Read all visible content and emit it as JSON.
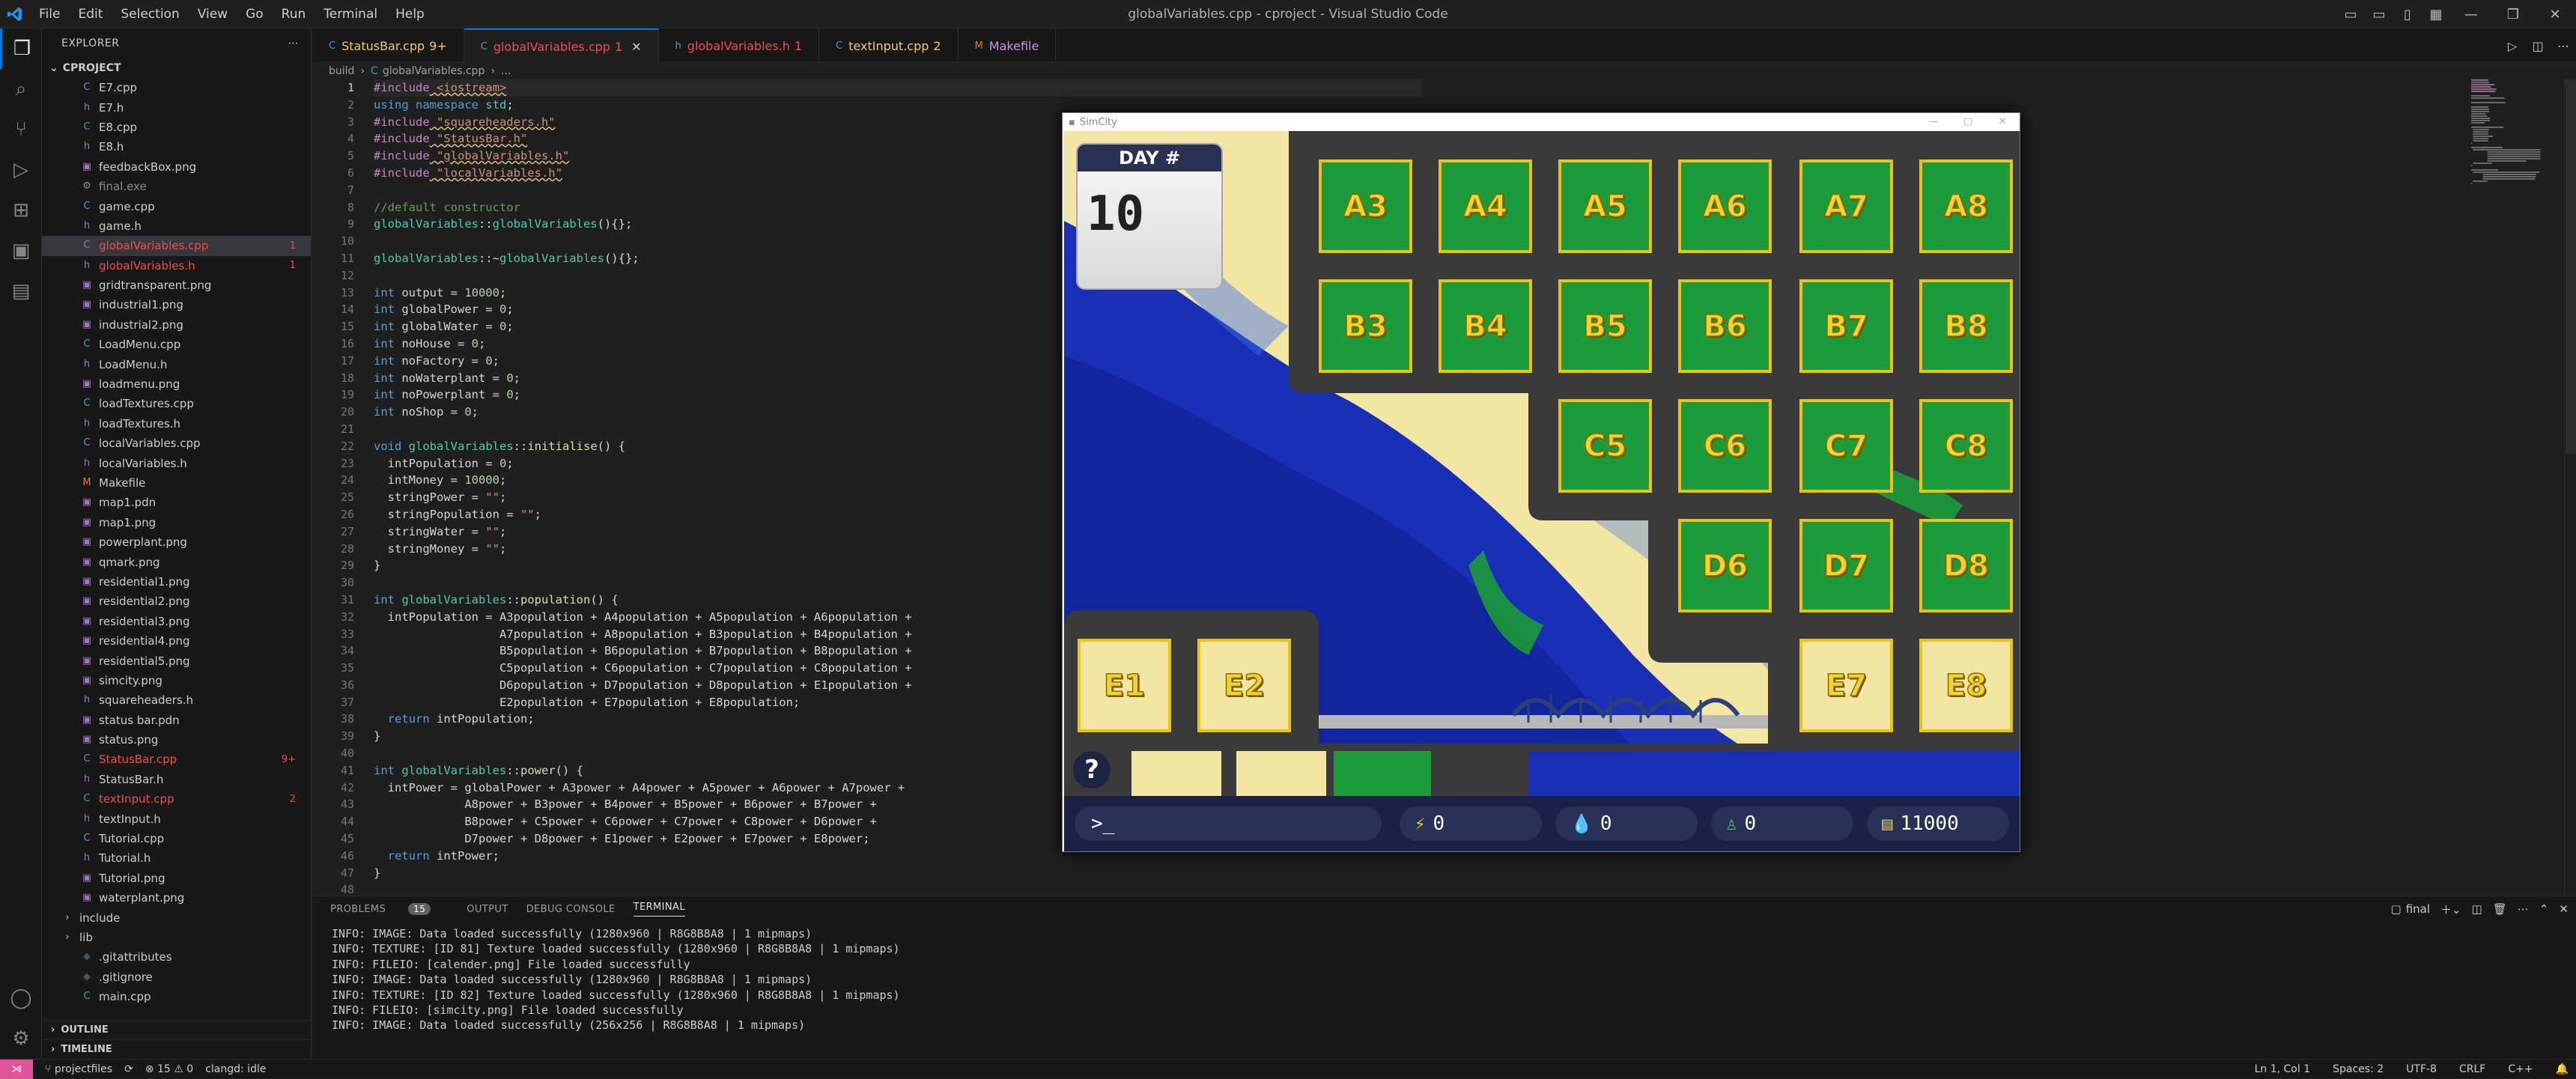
{
  "window": {
    "title": "globalVariables.cpp - cproject - Visual Studio Code"
  },
  "menu": [
    "File",
    "Edit",
    "Selection",
    "View",
    "Go",
    "Run",
    "Terminal",
    "Help"
  ],
  "activity": [
    "files-icon",
    "search-icon",
    "source-control-icon",
    "run-debug-icon",
    "extensions-icon",
    "remote-explorer-icon",
    "testing-icon"
  ],
  "sidebar": {
    "title": "EXPLORER",
    "project": "CPROJECT",
    "files": [
      {
        "name": "E7.cpp",
        "color": "#cccccc"
      },
      {
        "name": "E7.h",
        "color": "#cccccc"
      },
      {
        "name": "E8.cpp",
        "color": "#cccccc"
      },
      {
        "name": "E8.h",
        "color": "#cccccc"
      },
      {
        "name": "feedbackBox.png",
        "color": "#cccccc"
      },
      {
        "name": "final.exe",
        "color": "#8a8a8a"
      },
      {
        "name": "game.cpp",
        "color": "#cccccc"
      },
      {
        "name": "game.h",
        "color": "#cccccc"
      },
      {
        "name": "globalVariables.cpp",
        "color": "#f14c4c",
        "badge": "1",
        "selected": true
      },
      {
        "name": "globalVariables.h",
        "color": "#f14c4c",
        "badge": "1"
      },
      {
        "name": "gridtransparent.png",
        "color": "#cccccc"
      },
      {
        "name": "industrial1.png",
        "color": "#cccccc"
      },
      {
        "name": "industrial2.png",
        "color": "#cccccc"
      },
      {
        "name": "LoadMenu.cpp",
        "color": "#cccccc"
      },
      {
        "name": "LoadMenu.h",
        "color": "#cccccc"
      },
      {
        "name": "loadmenu.png",
        "color": "#cccccc"
      },
      {
        "name": "loadTextures.cpp",
        "color": "#cccccc"
      },
      {
        "name": "loadTextures.h",
        "color": "#cccccc"
      },
      {
        "name": "localVariables.cpp",
        "color": "#cccccc"
      },
      {
        "name": "localVariables.h",
        "color": "#cccccc"
      },
      {
        "name": "Makefile",
        "color": "#cccccc"
      },
      {
        "name": "map1.pdn",
        "color": "#cccccc"
      },
      {
        "name": "map1.png",
        "color": "#cccccc"
      },
      {
        "name": "powerplant.png",
        "color": "#cccccc"
      },
      {
        "name": "qmark.png",
        "color": "#cccccc"
      },
      {
        "name": "residential1.png",
        "color": "#cccccc"
      },
      {
        "name": "residential2.png",
        "color": "#cccccc"
      },
      {
        "name": "residential3.png",
        "color": "#cccccc"
      },
      {
        "name": "residential4.png",
        "color": "#cccccc"
      },
      {
        "name": "residential5.png",
        "color": "#cccccc"
      },
      {
        "name": "simcity.png",
        "color": "#cccccc"
      },
      {
        "name": "squareheaders.h",
        "color": "#cccccc"
      },
      {
        "name": "status bar.pdn",
        "color": "#cccccc"
      },
      {
        "name": "status.png",
        "color": "#cccccc"
      },
      {
        "name": "StatusBar.cpp",
        "color": "#f14c4c",
        "badge": "9+"
      },
      {
        "name": "StatusBar.h",
        "color": "#cccccc"
      },
      {
        "name": "textInput.cpp",
        "color": "#f14c4c",
        "badge": "2"
      },
      {
        "name": "textInput.h",
        "color": "#cccccc"
      },
      {
        "name": "Tutorial.cpp",
        "color": "#cccccc"
      },
      {
        "name": "Tutorial.h",
        "color": "#cccccc"
      },
      {
        "name": "Tutorial.png",
        "color": "#cccccc"
      },
      {
        "name": "waterplant.png",
        "color": "#cccccc"
      }
    ],
    "folders": [
      "include",
      "lib"
    ],
    "bottom_files": [
      ".gitattributes",
      ".gitignore",
      "main.cpp"
    ],
    "outline": "OUTLINE",
    "timeline": "TIMELINE"
  },
  "tabs": [
    {
      "label": "StatusBar.cpp",
      "badge": "9+",
      "color": "#f0c674"
    },
    {
      "label": "globalVariables.cpp",
      "badge": "1",
      "color": "#f14c4c",
      "active": true
    },
    {
      "label": "globalVariables.h",
      "badge": "1",
      "color": "#f14c4c"
    },
    {
      "label": "textInput.cpp",
      "badge": "2",
      "color": "#f0c674"
    },
    {
      "label": "Makefile",
      "badge": "",
      "color": "#c792ea"
    }
  ],
  "breadcrumb": [
    "build",
    "globalVariables.cpp",
    "..."
  ],
  "code": [
    "#include <iostream>",
    "using namespace std;",
    "#include \"squareheaders.h\"",
    "#include \"StatusBar.h\"",
    "#include \"globalVariables.h\"",
    "#include \"localVariables.h\"",
    "",
    "//default constructor",
    "globalVariables::globalVariables(){};",
    "",
    "globalVariables::~globalVariables(){};",
    "",
    "int output = 10000;",
    "int globalPower = 0;",
    "int globalWater = 0;",
    "int noHouse = 0;",
    "int noFactory = 0;",
    "int noWaterplant = 0;",
    "int noPowerplant = 0;",
    "int noShop = 0;",
    "",
    "void globalVariables::initialise() {",
    "  intPopulation = 0;",
    "  intMoney = 10000;",
    "  stringPower = \"\";",
    "  stringPopulation = \"\";",
    "  stringWater = \"\";",
    "  stringMoney = \"\";",
    "}",
    "",
    "int globalVariables::population() {",
    "  intPopulation = A3population + A4population + A5population + A6population +",
    "                  A7population + A8population + B3population + B4population +",
    "                  B5population + B6population + B7population + B8population +",
    "                  C5population + C6population + C7population + C8population +",
    "                  D6population + D7population + D8population + E1population +",
    "                  E2population + E7population + E8population;",
    "  return intPopulation;",
    "}",
    "",
    "int globalVariables::power() {",
    "  intPower = globalPower + A3power + A4power + A5power + A6power + A7power +",
    "             A8power + B3power + B4power + B5power + B6power + B7power +",
    "             B8power + C5power + C6power + C7power + C8power + D6power +",
    "             D7power + D8power + E1power + E2power + E7power + E8power;",
    "  return intPower;",
    "}",
    ""
  ],
  "panel": {
    "tabs": [
      "PROBLEMS",
      "OUTPUT",
      "DEBUG CONSOLE",
      "TERMINAL"
    ],
    "problems_count": "15",
    "terminal_name": "final",
    "lines": [
      "INFO: IMAGE: Data loaded successfully (1280x960 | R8G8B8A8 | 1 mipmaps)",
      "INFO: TEXTURE: [ID 81] Texture loaded successfully (1280x960 | R8G8B8A8 | 1 mipmaps)",
      "INFO: FILEIO: [calender.png] File loaded successfully",
      "INFO: IMAGE: Data loaded successfully (1280x960 | R8G8B8A8 | 1 mipmaps)",
      "INFO: TEXTURE: [ID 82] Texture loaded successfully (1280x960 | R8G8B8A8 | 1 mipmaps)",
      "INFO: FILEIO: [simcity.png] File loaded successfully",
      "INFO: IMAGE: Data loaded successfully (256x256 | R8G8B8A8 | 1 mipmaps)",
      ""
    ]
  },
  "game": {
    "title": "SimCity",
    "day_label": "DAY #",
    "day": "10",
    "help": "?",
    "prompt": ">_",
    "power": "0",
    "water": "0",
    "population": "0",
    "money": "11000",
    "plots": [
      "A3",
      "A4",
      "A5",
      "A6",
      "A7",
      "A8",
      "B3",
      "B4",
      "B5",
      "B6",
      "B7",
      "B8",
      "C5",
      "C6",
      "C7",
      "C8",
      "D6",
      "D7",
      "D8",
      "E1",
      "E2",
      "E7",
      "E8"
    ]
  },
  "status": {
    "branch": "projectfiles",
    "errors": "15",
    "warnings": "0",
    "clangd": "clangd: idle",
    "position": "Ln 1, Col 1",
    "spaces": "Spaces: 2",
    "encoding": "UTF-8",
    "eol": "CRLF",
    "lang": "C++"
  },
  "colors": {
    "accent": "#0078d4",
    "error": "#f14c4c",
    "remote": "#e0549c",
    "plot_green": "#1b9b3a",
    "plot_border": "#e8c31c",
    "water": "#1530a8",
    "sand": "#f3e6a4",
    "road": "#3a3a3a"
  }
}
